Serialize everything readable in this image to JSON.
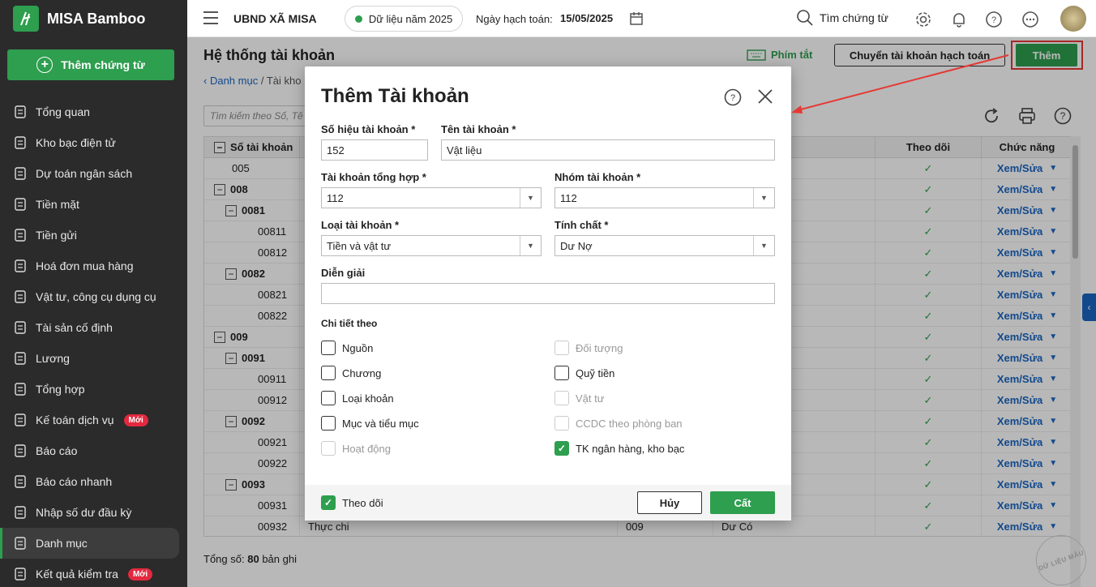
{
  "app": {
    "name": "MISA Bamboo",
    "new_doc_label": "Thêm chứng từ"
  },
  "sidebar": {
    "items": [
      {
        "label": "Tổng quan",
        "icon": "pie-chart-icon"
      },
      {
        "label": "Kho bạc điện tử",
        "icon": "monitor-icon"
      },
      {
        "label": "Dự toán ngân sách",
        "icon": "budget-icon"
      },
      {
        "label": "Tiền mặt",
        "icon": "cash-icon"
      },
      {
        "label": "Tiền gửi",
        "icon": "deposit-icon"
      },
      {
        "label": "Hoá đơn mua hàng",
        "icon": "invoice-icon"
      },
      {
        "label": "Vật tư, công cụ dụng cụ",
        "icon": "tools-icon"
      },
      {
        "label": "Tài sản cố định",
        "icon": "asset-icon"
      },
      {
        "label": "Lương",
        "icon": "salary-icon"
      },
      {
        "label": "Tổng hợp",
        "icon": "summary-icon"
      },
      {
        "label": "Kế toán dịch vụ",
        "icon": "service-icon",
        "badge": "Mới"
      },
      {
        "label": "Báo cáo",
        "icon": "report-icon"
      },
      {
        "label": "Báo cáo nhanh",
        "icon": "quick-report-icon"
      },
      {
        "label": "Nhập số dư đầu kỳ",
        "icon": "opening-balance-icon"
      },
      {
        "label": "Danh mục",
        "icon": "catalog-icon",
        "active": true
      },
      {
        "label": "Kết quả kiểm tra",
        "icon": "check-result-icon",
        "badge": "Mới"
      }
    ]
  },
  "topbar": {
    "unit": "UBND XÃ MISA",
    "data_year": "Dữ liệu năm 2025",
    "posting_date_label": "Ngày hạch toán:",
    "posting_date": "15/05/2025",
    "search_label": "Tìm chứng từ"
  },
  "page": {
    "title": "Hệ thống tài khoản",
    "breadcrumb_link": "Danh mục",
    "breadcrumb_current": "/ Tài kho",
    "shortcut_label": "Phím tắt",
    "transfer_label": "Chuyển tài khoản hạch toán",
    "add_label": "Thêm",
    "search_placeholder": "Tìm kiếm theo Số, Tê",
    "total_label": "Tổng số:",
    "total_value": "80",
    "total_unit": "bản ghi"
  },
  "table": {
    "headers": {
      "account": "Số tài khoản",
      "follow": "Theo dõi",
      "function": "Chức năng"
    },
    "edit_label": "Xem/Sửa",
    "rows": [
      {
        "acc": "005",
        "level": 0,
        "expand": false,
        "bold": false
      },
      {
        "acc": "008",
        "level": 0,
        "expand": true,
        "bold": true
      },
      {
        "acc": "0081",
        "level": 1,
        "expand": true,
        "bold": true
      },
      {
        "acc": "00811",
        "level": 2,
        "expand": false,
        "bold": false
      },
      {
        "acc": "00812",
        "level": 2,
        "expand": false,
        "bold": false
      },
      {
        "acc": "0082",
        "level": 1,
        "expand": true,
        "bold": true
      },
      {
        "acc": "00821",
        "level": 2,
        "expand": false,
        "bold": false
      },
      {
        "acc": "00822",
        "level": 2,
        "expand": false,
        "bold": false
      },
      {
        "acc": "009",
        "level": 0,
        "expand": true,
        "bold": true
      },
      {
        "acc": "0091",
        "level": 1,
        "expand": true,
        "bold": true
      },
      {
        "acc": "00911",
        "level": 2,
        "expand": false,
        "bold": false
      },
      {
        "acc": "00912",
        "level": 2,
        "expand": false,
        "bold": false
      },
      {
        "acc": "0092",
        "level": 1,
        "expand": true,
        "bold": true
      },
      {
        "acc": "00921",
        "level": 2,
        "expand": false,
        "bold": false
      },
      {
        "acc": "00922",
        "level": 2,
        "expand": false,
        "bold": false
      },
      {
        "acc": "0093",
        "level": 1,
        "expand": true,
        "bold": true
      },
      {
        "acc": "00931",
        "level": 2,
        "expand": false,
        "bold": false
      },
      {
        "acc": "00932",
        "level": 2,
        "expand": false,
        "bold": false,
        "name": "Thực chi",
        "parent": "009",
        "nature": "Dư Có"
      }
    ]
  },
  "modal": {
    "title": "Thêm Tài khoản",
    "account_no_label": "Số hiệu tài khoản *",
    "account_no_value": "152",
    "account_name_label": "Tên tài khoản *",
    "account_name_value": "Vật liệu",
    "parent_label": "Tài khoản tổng hợp *",
    "parent_value": "112",
    "group_label": "Nhóm tài khoản *",
    "group_value": "112",
    "type_label": "Loại tài khoản *",
    "type_value": "Tiền và vật tư",
    "nature_label": "Tính chất *",
    "nature_value": "Dư Nợ",
    "description_label": "Diễn giải",
    "description_value": "",
    "detail_label": "Chi tiết theo",
    "left_options": [
      {
        "label": "Nguồn",
        "state": "unchecked"
      },
      {
        "label": "Chương",
        "state": "unchecked"
      },
      {
        "label": "Loại khoản",
        "state": "unchecked"
      },
      {
        "label": "Mục và tiểu mục",
        "state": "unchecked"
      },
      {
        "label": "Hoạt động",
        "state": "disabled"
      }
    ],
    "right_options": [
      {
        "label": "Đối tượng",
        "state": "disabled"
      },
      {
        "label": "Quỹ tiền",
        "state": "unchecked"
      },
      {
        "label": "Vật tư",
        "state": "disabled"
      },
      {
        "label": "CCDC theo phòng ban",
        "state": "disabled"
      },
      {
        "label": "TK ngân hàng, kho bạc",
        "state": "checked"
      }
    ],
    "follow_label": "Theo dõi",
    "cancel_label": "Hủy",
    "save_label": "Cất"
  },
  "watermark": {
    "text": "DỮ LIỆU MẪU"
  },
  "colors": {
    "brand_green": "#2e9e4f",
    "link_blue": "#1a66c2",
    "highlight_red": "#e53935",
    "sidebar_bg": "#2b2b2b"
  }
}
